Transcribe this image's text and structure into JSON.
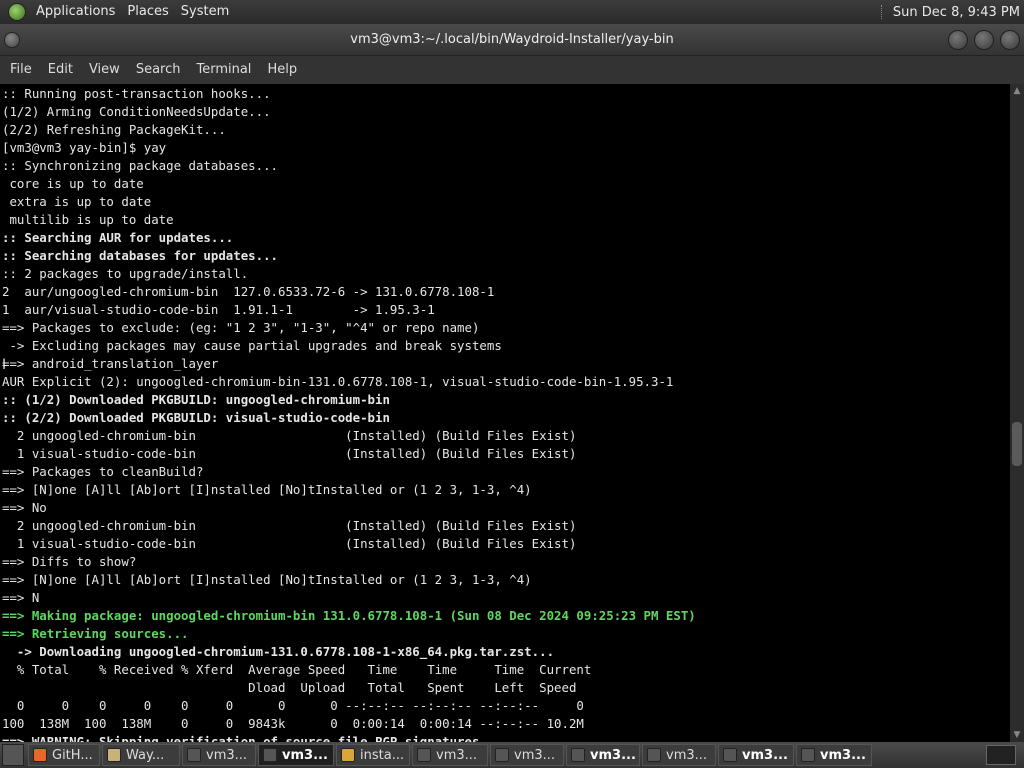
{
  "top_panel": {
    "menus": [
      "Applications",
      "Places",
      "System"
    ],
    "clock": "Sun Dec 8, 9:43 PM"
  },
  "window": {
    "title": "vm3@vm3:~/.local/bin/Waydroid-Installer/yay-bin"
  },
  "menubar": [
    "File",
    "Edit",
    "View",
    "Search",
    "Terminal",
    "Help"
  ],
  "terminal": {
    "lines": [
      {
        "text": ":: Running post-transaction hooks...",
        "style": ""
      },
      {
        "text": "(1/2) Arming ConditionNeedsUpdate...",
        "style": ""
      },
      {
        "text": "(2/2) Refreshing PackageKit...",
        "style": ""
      },
      {
        "text": "[vm3@vm3 yay-bin]$ yay",
        "style": ""
      },
      {
        "text": ":: Synchronizing package databases...",
        "style": ""
      },
      {
        "text": " core is up to date",
        "style": ""
      },
      {
        "text": " extra is up to date",
        "style": ""
      },
      {
        "text": " multilib is up to date",
        "style": ""
      },
      {
        "text": ":: Searching AUR for updates...",
        "style": "b"
      },
      {
        "text": ":: Searching databases for updates...",
        "style": "b"
      },
      {
        "text": ":: 2 packages to upgrade/install.",
        "style": ""
      },
      {
        "text": "2  aur/ungoogled-chromium-bin  127.0.6533.72-6 -> 131.0.6778.108-1",
        "style": ""
      },
      {
        "text": "1  aur/visual-studio-code-bin  1.91.1-1        -> 1.95.3-1",
        "style": ""
      },
      {
        "text": "==> Packages to exclude: (eg: \"1 2 3\", \"1-3\", \"^4\" or repo name)",
        "style": ""
      },
      {
        "text": " -> Excluding packages may cause partial upgrades and break systems",
        "style": ""
      },
      {
        "text": "==> android_translation_layer",
        "style": ""
      },
      {
        "text": "AUR Explicit (2): ungoogled-chromium-bin-131.0.6778.108-1, visual-studio-code-bin-1.95.3-1",
        "style": ""
      },
      {
        "text": ":: (1/2) Downloaded PKGBUILD: ungoogled-chromium-bin",
        "style": "b"
      },
      {
        "text": ":: (2/2) Downloaded PKGBUILD: visual-studio-code-bin",
        "style": "b"
      },
      {
        "text": "  2 ungoogled-chromium-bin                    (Installed) (Build Files Exist)",
        "style": ""
      },
      {
        "text": "  1 visual-studio-code-bin                    (Installed) (Build Files Exist)",
        "style": ""
      },
      {
        "text": "==> Packages to cleanBuild?",
        "style": ""
      },
      {
        "text": "==> [N]one [A]ll [Ab]ort [I]nstalled [No]tInstalled or (1 2 3, 1-3, ^4)",
        "style": ""
      },
      {
        "text": "==> No",
        "style": ""
      },
      {
        "text": "  2 ungoogled-chromium-bin                    (Installed) (Build Files Exist)",
        "style": ""
      },
      {
        "text": "  1 visual-studio-code-bin                    (Installed) (Build Files Exist)",
        "style": ""
      },
      {
        "text": "==> Diffs to show?",
        "style": ""
      },
      {
        "text": "==> [N]one [A]ll [Ab]ort [I]nstalled [No]tInstalled or (1 2 3, 1-3, ^4)",
        "style": ""
      },
      {
        "text": "==> N",
        "style": ""
      },
      {
        "text": "==> Making package: ungoogled-chromium-bin 131.0.6778.108-1 (Sun 08 Dec 2024 09:25:23 PM EST)",
        "style": "g"
      },
      {
        "text": "==> Retrieving sources...",
        "style": "g"
      },
      {
        "text": "  -> Downloading ungoogled-chromium-131.0.6778.108-1-x86_64.pkg.tar.zst...",
        "style": "b"
      },
      {
        "text": "  % Total    % Received % Xferd  Average Speed   Time    Time     Time  Current",
        "style": ""
      },
      {
        "text": "                                 Dload  Upload   Total   Spent    Left  Speed",
        "style": ""
      },
      {
        "text": "  0     0    0     0    0     0      0      0 --:--:-- --:--:-- --:--:--     0",
        "style": ""
      },
      {
        "text": "100  138M  100  138M    0     0  9843k      0  0:00:14  0:00:14 --:--:-- 10.2M",
        "style": ""
      },
      {
        "text": "==> WARNING: Skipping verification of source file PGP signatures.",
        "style": "b"
      }
    ]
  },
  "taskbar": {
    "tasks": [
      {
        "label": "GitH...",
        "icon_color": "#e8662a",
        "active": false,
        "bold": false
      },
      {
        "label": "Way...",
        "icon_color": "#c8b27a",
        "active": false,
        "bold": false
      },
      {
        "label": "vm3...",
        "icon_color": "#555555",
        "active": false,
        "bold": false
      },
      {
        "label": "vm3...",
        "icon_color": "#555555",
        "active": true,
        "bold": false
      },
      {
        "label": "insta...",
        "icon_color": "#d9a63a",
        "active": false,
        "bold": false
      },
      {
        "label": "vm3...",
        "icon_color": "#555555",
        "active": false,
        "bold": false
      },
      {
        "label": "vm3...",
        "icon_color": "#555555",
        "active": false,
        "bold": false
      },
      {
        "label": "vm3...",
        "icon_color": "#555555",
        "active": false,
        "bold": true
      },
      {
        "label": "vm3...",
        "icon_color": "#555555",
        "active": false,
        "bold": false
      },
      {
        "label": "vm3...",
        "icon_color": "#555555",
        "active": false,
        "bold": true
      },
      {
        "label": "vm3...",
        "icon_color": "#555555",
        "active": false,
        "bold": true
      }
    ]
  }
}
